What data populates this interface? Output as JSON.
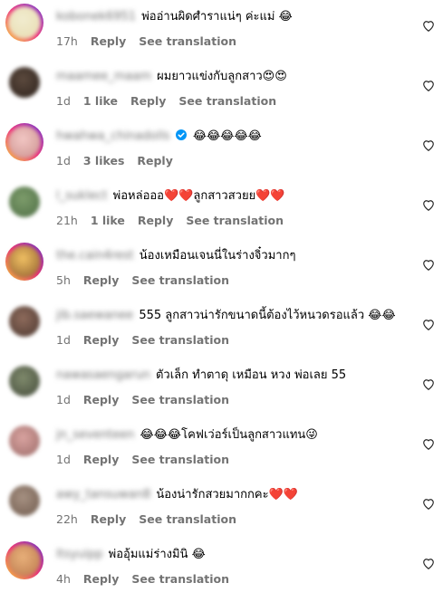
{
  "comments": [
    {
      "username": "kobonek6951",
      "text": "พ่ออ่านผิดศำราแน่ๆ ค่ะแม่ 😂",
      "time": "17h",
      "likes": "",
      "reply": "Reply",
      "translation": "See translation",
      "verified": false,
      "avatar_colors": [
        "#f1eccf",
        "#e7dbaf"
      ],
      "ring": true
    },
    {
      "username": "maamee_maam",
      "text": "ผมยาวแข่งกับลูกสาว😍😍",
      "time": "1d",
      "likes": "1 like",
      "reply": "Reply",
      "translation": "See translation",
      "verified": false,
      "avatar_colors": [
        "#5c4a3e",
        "#2c211b"
      ],
      "ring": false
    },
    {
      "username": "hwahwa_chinadolls",
      "text": "😂😂😂😂😂",
      "time": "1d",
      "likes": "3 likes",
      "reply": "Reply",
      "translation": "",
      "verified": true,
      "avatar_colors": [
        "#f2c7c4",
        "#c98f8c"
      ],
      "ring": true
    },
    {
      "username": "l_suklect",
      "text": "พ่อหล่อออ❤️❤️ลูกสาวสวยย❤️❤️",
      "time": "21h",
      "likes": "1 like",
      "reply": "Reply",
      "translation": "See translation",
      "verified": false,
      "avatar_colors": [
        "#7d9c6b",
        "#4e6e45"
      ],
      "ring": false
    },
    {
      "username": "the.cain4rest",
      "text": "น้องเหมือนเจนนี่ในร่างจิ๋วมากๆ",
      "time": "5h",
      "likes": "",
      "reply": "Reply",
      "translation": "See translation",
      "verified": false,
      "avatar_colors": [
        "#f0c063",
        "#8a5a2b"
      ],
      "ring": true
    },
    {
      "username": "jib.saewanee",
      "text": "555 ลูกสาวน่ารักขนาดนี้ต้องไว้หนวดรอแล้ว 😂😂",
      "time": "1d",
      "likes": "",
      "reply": "Reply",
      "translation": "See translation",
      "verified": false,
      "avatar_colors": [
        "#8e6b5c",
        "#4b372f"
      ],
      "ring": false
    },
    {
      "username": "nawasaengarun",
      "text": "ตัวเล็ก ทำตาดุ เหมือน หวง พ่อเลย 55",
      "time": "1d",
      "likes": "",
      "reply": "Reply",
      "translation": "See translation",
      "verified": false,
      "avatar_colors": [
        "#7f8a6c",
        "#444b3b"
      ],
      "ring": false
    },
    {
      "username": "jn_seventeen",
      "text": "😂😂😂โคฟเว่อร์เป็นลูกสาวแทน😜",
      "time": "1d",
      "likes": "",
      "reply": "Reply",
      "translation": "See translation",
      "verified": false,
      "avatar_colors": [
        "#d9a3a0",
        "#9b6b68"
      ],
      "ring": false
    },
    {
      "username": "awy_tansuwan8",
      "text": "น้องน่ารักสวยมากกคะ❤️❤️",
      "time": "22h",
      "likes": "",
      "reply": "Reply",
      "translation": "See translation",
      "verified": false,
      "avatar_colors": [
        "#a69182",
        "#6f5a4d"
      ],
      "ring": false
    },
    {
      "username": "ltsyuipp",
      "text": "พ่ออุ้มแม่ร่างมินิ 😂",
      "time": "4h",
      "likes": "",
      "reply": "Reply",
      "translation": "See translation",
      "verified": false,
      "avatar_colors": [
        "#e8b07a",
        "#b8764a"
      ],
      "ring": true
    }
  ],
  "colors": {
    "muted": "#737373",
    "verified": "#0095f6"
  }
}
